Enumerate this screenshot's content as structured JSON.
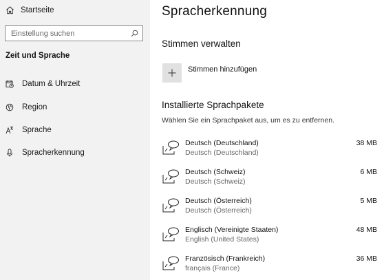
{
  "sidebar": {
    "home_label": "Startseite",
    "search_placeholder": "Einstellung suchen",
    "section_title": "Zeit und Sprache",
    "items": [
      {
        "label": "Datum & Uhrzeit",
        "icon": "calendar-clock-icon"
      },
      {
        "label": "Region",
        "icon": "globe-icon"
      },
      {
        "label": "Sprache",
        "icon": "language-icon"
      },
      {
        "label": "Spracherkennung",
        "icon": "microphone-icon"
      }
    ]
  },
  "main": {
    "title": "Spracherkennung",
    "voices_heading": "Stimmen verwalten",
    "add_voice_label": "Stimmen hinzufügen",
    "packs_heading": "Installierte Sprachpakete",
    "packs_hint": "Wählen Sie ein Sprachpaket aus, um es zu entfernen.",
    "packs": [
      {
        "name": "Deutsch (Deutschland)",
        "sub": "Deutsch (Deutschland)",
        "size": "38 MB"
      },
      {
        "name": "Deutsch (Schweiz)",
        "sub": "Deutsch (Schweiz)",
        "size": "6 MB"
      },
      {
        "name": "Deutsch (Österreich)",
        "sub": "Deutsch (Österreich)",
        "size": "5 MB"
      },
      {
        "name": "Englisch (Vereinigte Staaten)",
        "sub": "English (United States)",
        "size": "48 MB"
      },
      {
        "name": "Französisch (Frankreich)",
        "sub": "français (France)",
        "size": "36 MB"
      }
    ]
  },
  "colors": {
    "sidebar_bg": "#f2f2f2",
    "tile_bg": "#e1e1e1"
  }
}
